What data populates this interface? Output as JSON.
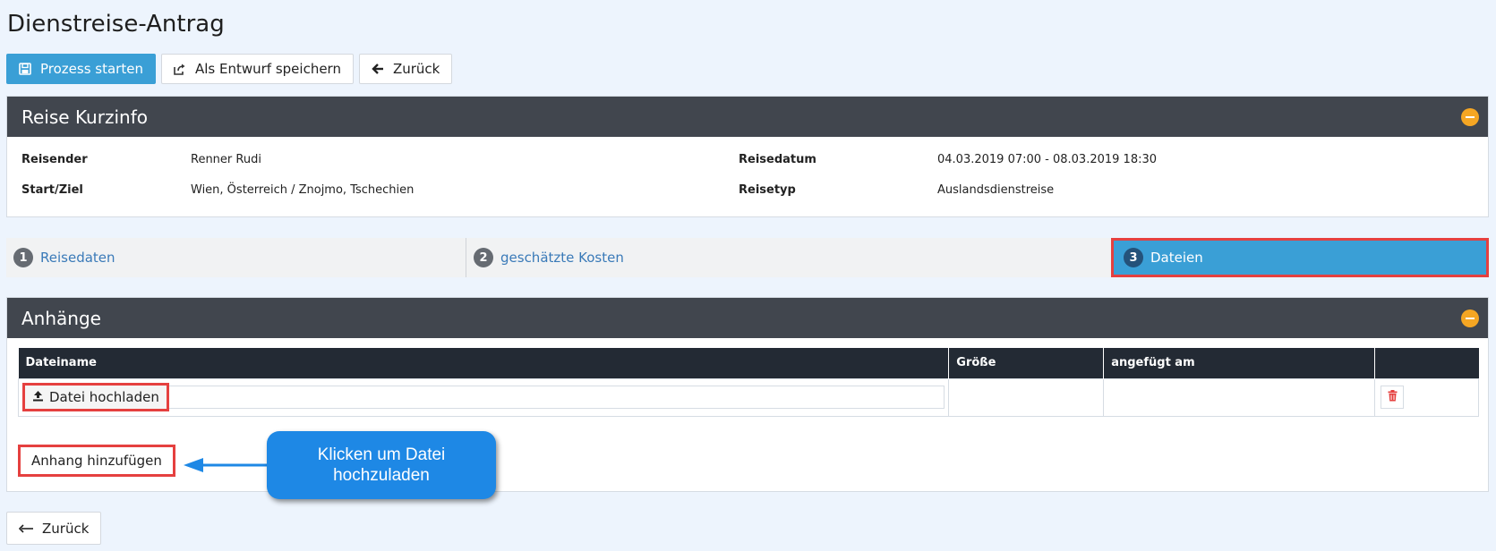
{
  "page": {
    "title": "Dienstreise-Antrag"
  },
  "toolbar": {
    "start_label": "Prozess starten",
    "draft_label": "Als Entwurf speichern",
    "back_label": "Zurück"
  },
  "trip_info": {
    "title": "Reise Kurzinfo",
    "traveler_label": "Reisender",
    "traveler_value": "Renner Rudi",
    "route_label": "Start/Ziel",
    "route_value": "Wien, Österreich / Znojmo, Tschechien",
    "date_label": "Reisedatum",
    "date_value": "04.03.2019 07:00 - 08.03.2019 18:30",
    "type_label": "Reisetyp",
    "type_value": "Auslandsdienstreise"
  },
  "steps": [
    {
      "num": "1",
      "label": "Reisedaten",
      "active": false
    },
    {
      "num": "2",
      "label": "geschätzte Kosten",
      "active": false
    },
    {
      "num": "3",
      "label": "Dateien",
      "active": true
    }
  ],
  "attachments": {
    "title": "Anhänge",
    "columns": [
      "Dateiname",
      "Größe",
      "angefügt am",
      ""
    ],
    "upload_label": "Datei hochladen",
    "add_label": "Anhang hinzufügen"
  },
  "callout": {
    "text": "Klicken um Datei hochzuladen"
  },
  "footer": {
    "back_label": "Zurück"
  },
  "colors": {
    "primary": "#3a9fd6",
    "header_dark": "#41464e",
    "highlight": "#e5403f",
    "collapse": "#f5a623",
    "callout": "#1e88e5"
  }
}
